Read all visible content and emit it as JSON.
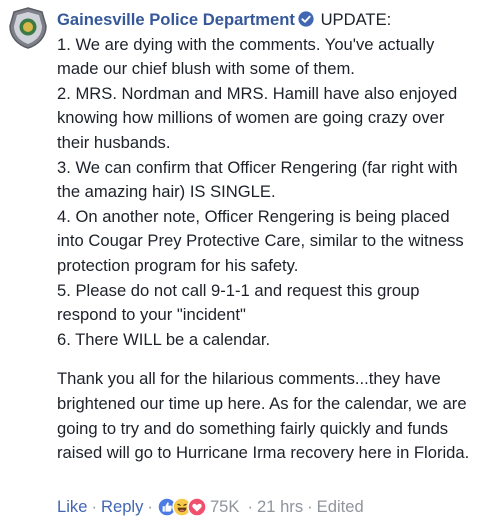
{
  "comment": {
    "author": "Gainesville Police Department",
    "first_line": "UPDATE:",
    "lines": [
      "1. We are dying with the comments. You've actually made our chief blush with some of them.",
      "2. MRS. Nordman and MRS. Hamill have also enjoyed knowing how millions of women are going crazy over their husbands.",
      "3. We can confirm that Officer Rengering (far right with the amazing hair) IS SINGLE.",
      "4. On another note, Officer Rengering is being placed into Cougar Prey Protective Care, similar to the witness protection program for his safety.",
      "5. Please do not call 9-1-1 and request this group respond to your \"incident\"",
      "6. There WILL be a calendar."
    ],
    "closing": "Thank you all for the hilarious comments...they have brightened our time up here. As for the calendar, we are going to try and do something fairly quickly and funds raised will go to Hurricane Irma recovery here in Florida."
  },
  "actions": {
    "like_label": "Like",
    "reply_label": "Reply",
    "reaction_count": "75K",
    "timestamp": "21 hrs",
    "edited_label": "Edited",
    "separator": "·"
  },
  "icons": {
    "avatar": "police-badge-icon",
    "verified": "verified-check-icon",
    "reactions": [
      "like-reaction-icon",
      "haha-reaction-icon",
      "love-reaction-icon"
    ]
  },
  "colors": {
    "author": "#365899",
    "link": "#4267b2",
    "meta": "#90949c",
    "text": "#1d2129"
  }
}
